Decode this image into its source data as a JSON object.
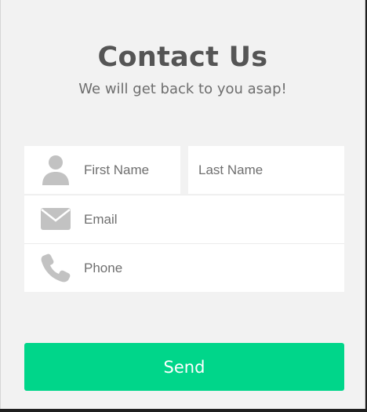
{
  "header": {
    "title": "Contact Us",
    "subtitle": "We will get back to you asap!"
  },
  "form": {
    "first_name": {
      "placeholder": "First Name",
      "value": "",
      "icon": "user-icon"
    },
    "last_name": {
      "placeholder": "Last Name",
      "value": ""
    },
    "email": {
      "placeholder": "Email",
      "value": "",
      "icon": "envelope-icon"
    },
    "phone": {
      "placeholder": "Phone",
      "value": "",
      "icon": "phone-icon"
    },
    "submit_label": "Send"
  },
  "colors": {
    "background": "#f2f2f2",
    "field_background": "#ffffff",
    "icon": "#c2c2c2",
    "heading": "#555555",
    "accent": "#00d68a",
    "button_text": "#ffffff"
  }
}
